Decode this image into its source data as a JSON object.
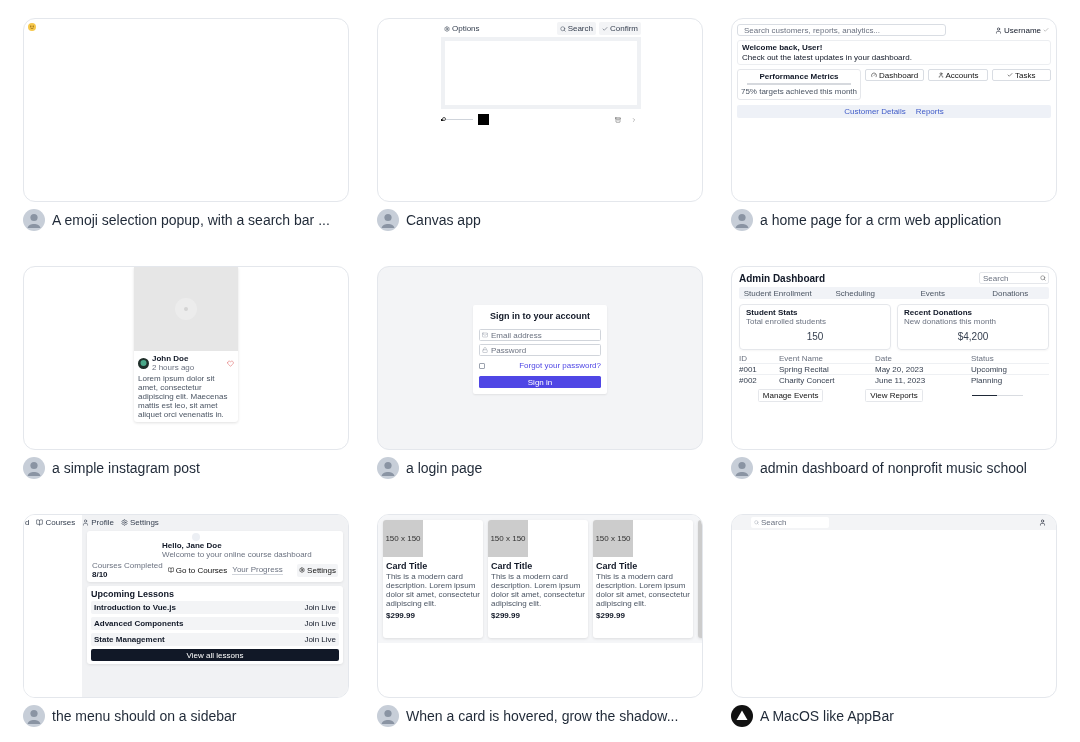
{
  "gallery": [
    {
      "kind": "emoji",
      "avatar": {
        "kind": "person"
      },
      "caption": "A emoji selection popup, with a search bar ..."
    },
    {
      "kind": "canvas",
      "avatar": {
        "kind": "person"
      },
      "caption": "Canvas app",
      "options": "Options",
      "search": "Search",
      "confirm": "Confirm",
      "brush": {
        "level": 0.1
      }
    },
    {
      "kind": "crm",
      "avatar": {
        "kind": "person"
      },
      "caption": "a home page for a crm web application",
      "search": {
        "placeholder": "Search customers, reports, analytics..."
      },
      "user": "Username",
      "welcome": {
        "title": "Welcome back, User!",
        "subtitle": "Check out the latest updates in your dashboard."
      },
      "metrics": {
        "title": "Performance Metrics",
        "level": 1,
        "note": "75% targets achieved this month"
      },
      "buttons": [
        "Dashboard",
        "Accounts",
        "Tasks"
      ],
      "tabs": [
        "Customer Details",
        "Reports"
      ]
    },
    {
      "kind": "post",
      "avatar": {
        "kind": "person"
      },
      "caption": "a simple instagram post",
      "author": "John Doe",
      "time": "2 hours ago",
      "text": "Lorem ipsum dolor sit amet, consectetur adipiscing elit. Maecenas mattis est leo, sit amet aliquet orci venenatis in.",
      "liked": false
    },
    {
      "kind": "login",
      "avatar": {
        "kind": "person"
      },
      "caption": "a login page",
      "title": "Sign in to your account",
      "email": {
        "placeholder": "Email address"
      },
      "password": {
        "placeholder": "Password"
      },
      "remember": {
        "checked": false
      },
      "forgot": "Forgot your password?",
      "submit": "Sign in"
    },
    {
      "kind": "admin",
      "avatar": {
        "kind": "person"
      },
      "caption": "admin dashboard of nonprofit music school",
      "title": "Admin Dashboard",
      "search": {
        "placeholder": "Search"
      },
      "tabs": [
        "Student Enrollment",
        "Scheduling",
        "Events",
        "Donations"
      ],
      "stats": [
        {
          "title": "Student Stats",
          "subtitle": "Total enrolled students",
          "value": "150"
        },
        {
          "title": "Recent Donations",
          "subtitle": "New donations this month",
          "value": "$4,200"
        }
      ],
      "columns": [
        "ID",
        "Event Name",
        "Date",
        "Status"
      ],
      "rows": [
        [
          "#001",
          "Spring Recital",
          "May 20, 2023",
          "Upcoming"
        ],
        [
          "#002",
          "Charity Concert",
          "June 11, 2023",
          "Planning"
        ]
      ],
      "buttons": [
        "Manage Events",
        "View Reports"
      ],
      "progress": {
        "level": 0.5
      }
    },
    {
      "kind": "courses",
      "avatar": {
        "kind": "person"
      },
      "caption": "the menu should on a sidebar",
      "nav": [
        "d",
        "Courses",
        "Profile",
        "Settings"
      ],
      "greeting": "Hello, Jane Doe",
      "subtitle": "Welcome to your online course dashboard",
      "stat_label": "Courses Completed",
      "stat_value": "8/10",
      "go": "Go to Courses",
      "progress_label": "Your Progress",
      "settings": "Settings",
      "lessons_title": "Upcoming Lessons",
      "lessons": [
        {
          "title": "Introduction to Vue.js",
          "action": "Join Live"
        },
        {
          "title": "Advanced Components",
          "action": "Join Live"
        },
        {
          "title": "State Management",
          "action": "Join Live"
        }
      ],
      "view_all": "View all lessons"
    },
    {
      "kind": "cards",
      "avatar": {
        "kind": "person"
      },
      "caption": "When a card is hovered, grow the shadow...",
      "products": [
        {
          "image_label": "150 x 150",
          "title": "Card Title",
          "description": "This is a modern card description. Lorem ipsum dolor sit amet, consectetur adipiscing elit.",
          "price": "$299.99"
        },
        {
          "image_label": "150 x 150",
          "title": "Card Title",
          "description": "This is a modern card description. Lorem ipsum dolor sit amet, consectetur adipiscing elit.",
          "price": "$299.99"
        },
        {
          "image_label": "150 x 150",
          "title": "Card Title",
          "description": "This is a modern card description. Lorem ipsum dolor sit amet, consectetur adipiscing elit.",
          "price": "$299.99"
        }
      ]
    },
    {
      "kind": "appbar",
      "avatar": {
        "kind": "logo"
      },
      "caption": "A MacOS like AppBar",
      "search": {
        "placeholder": "Search"
      }
    }
  ]
}
